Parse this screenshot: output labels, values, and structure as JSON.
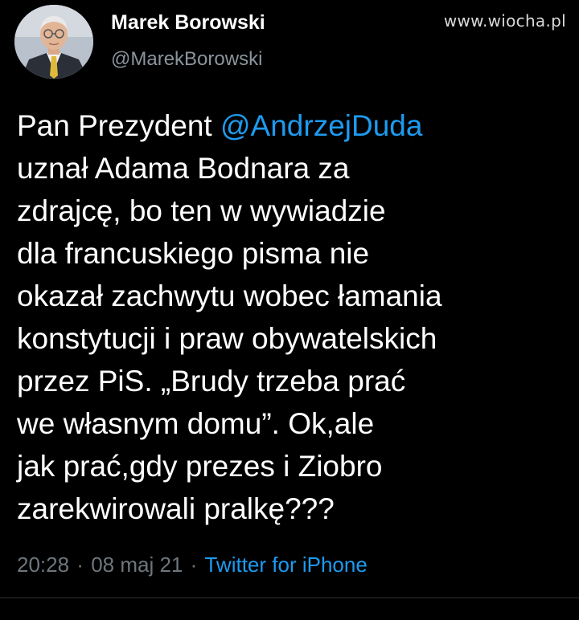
{
  "watermark": "www.wiocha.pl",
  "author": {
    "name": "Marek Borowski",
    "handle": "@MarekBorowski"
  },
  "tweet": {
    "line1_prefix": "Pan Prezydent ",
    "line1_mention": "@AndrzejDuda",
    "lines": [
      "uznał Adama Bodnara za",
      "zdrajcę, bo ten w wywiadzie",
      "dla francuskiego pisma nie",
      "okazał zachwytu wobec łamania",
      "konstytucji i praw obywatelskich",
      "przez PiS. „Brudy trzeba prać",
      "we własnym domu”. Ok,ale",
      "jak prać,gdy prezes i Ziobro",
      "zarekwirowali pralkę???"
    ]
  },
  "meta": {
    "time": "20:28",
    "separator": " · ",
    "date": "08 maj 21",
    "source": "Twitter for iPhone"
  },
  "colors": {
    "background": "#000000",
    "text": "#ffffff",
    "link": "#1d9bf0",
    "muted": "#6e767d"
  }
}
